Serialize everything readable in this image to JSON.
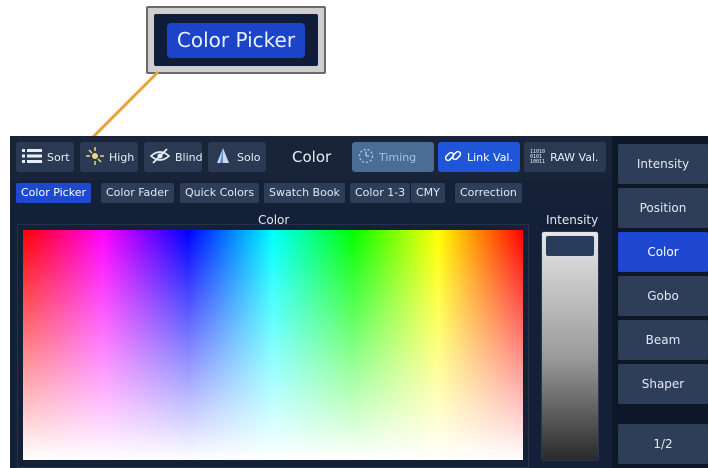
{
  "callout": {
    "label": "Color Picker"
  },
  "toolbar": {
    "sort": "Sort",
    "high": "High",
    "blind": "Blind",
    "solo": "Solo",
    "title": "Color",
    "timing": "Timing",
    "link": "Link Val.",
    "raw": "RAW Val.",
    "raw_icon_text": "11010\n0101\n10011"
  },
  "tabs": [
    "Color Picker",
    "Color Fader",
    "Quick Colors",
    "Swatch Book",
    "Color 1-3",
    "CMY",
    "Correction"
  ],
  "main": {
    "color_label": "Color",
    "intensity_label": "Intensity"
  },
  "sidebar": {
    "items": [
      "Intensity",
      "Position",
      "Color",
      "Gobo",
      "Beam",
      "Shaper"
    ],
    "page": "1/2"
  },
  "colors": {
    "accent": "#1f48d2",
    "callout_arrow": "#e8a33a"
  }
}
